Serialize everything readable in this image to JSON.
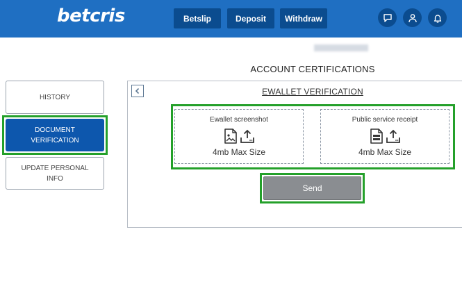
{
  "header": {
    "logo": "betcris",
    "nav": {
      "betslip": "Betslip",
      "deposit": "Deposit",
      "withdraw": "Withdraw"
    },
    "icons": [
      "chat-icon",
      "user-icon",
      "bell-icon"
    ]
  },
  "user": {
    "name_blurred": "●●●●● ●●●●●"
  },
  "page": {
    "title": "ACCOUNT CERTIFICATIONS"
  },
  "sidebar": {
    "items": [
      {
        "label": "HISTORY",
        "active": false
      },
      {
        "label": "DOCUMENT VERIFICATION",
        "active": true
      },
      {
        "label": "UPDATE PERSONAL INFO",
        "active": false
      }
    ]
  },
  "panel": {
    "title": "EWALLET VERIFICATION",
    "uploads": [
      {
        "label": "Ewallet screenshot",
        "size": "4mb Max Size",
        "icon": "image-file-icon"
      },
      {
        "label": "Public service receipt",
        "size": "4mb Max Size",
        "icon": "document-file-icon"
      }
    ],
    "send_label": "Send"
  },
  "colors": {
    "brand": "#1f6fc2",
    "nav_button": "#0b4c8f",
    "active": "#0d57ad",
    "highlight": "#24a02a",
    "send": "#8a8d91"
  }
}
